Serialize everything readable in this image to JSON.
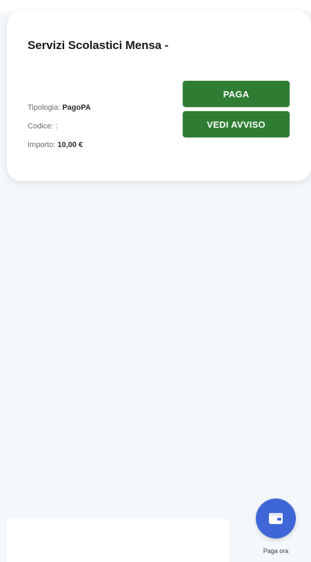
{
  "notice": {
    "title": "Servizi Scolastici Mensa -",
    "type_label": "Tipologia: ",
    "type_value": "PagoPA",
    "code_label": "Codice: :",
    "amount_label": "Importo: ",
    "amount_value": "10,00 €"
  },
  "actions": {
    "pay_label": "PAGA",
    "view_notice_label": "VEDI AVVISO"
  },
  "fab": {
    "label": "Paga ora",
    "icon": "wallet-icon",
    "color": "#3f66d6"
  },
  "colors": {
    "primary_button": "#2e7d32",
    "background": "#f5f8fb"
  }
}
